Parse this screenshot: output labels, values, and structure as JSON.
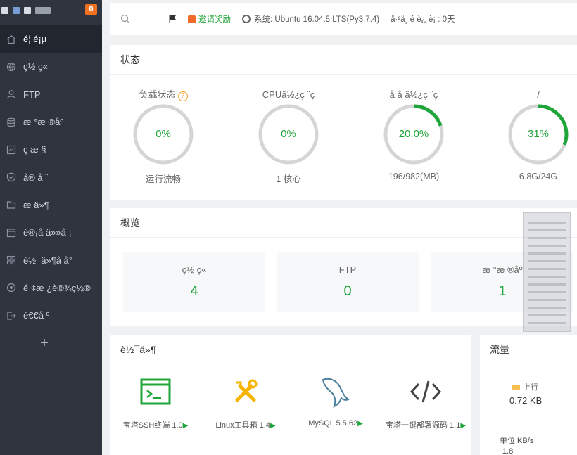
{
  "sidebar": {
    "badge": "0",
    "items": [
      {
        "label": "é¦ é¡µ",
        "icon": "home-icon",
        "active": true
      },
      {
        "label": "ç½ ç«",
        "icon": "globe-icon"
      },
      {
        "label": "FTP",
        "icon": "user-icon"
      },
      {
        "label": "æ °æ ®åº",
        "icon": "database-icon"
      },
      {
        "label": "ç æ §",
        "icon": "monitor-icon"
      },
      {
        "label": "å® å ¨",
        "icon": "shield-icon"
      },
      {
        "label": "æ ä»¶",
        "icon": "folder-icon"
      },
      {
        "label": "è®¡å ä»»å ¡",
        "icon": "task-icon"
      },
      {
        "label": "è½¯ä»¶å å°",
        "icon": "grid-icon"
      },
      {
        "label": "é ¢æ ¿è®¾ç½®",
        "icon": "settings-icon"
      },
      {
        "label": "é€€å º",
        "icon": "logout-icon"
      }
    ],
    "add_label": "+"
  },
  "header": {
    "invite": "邀请奖励",
    "system": "系统:  Ubuntu 16.04.5 LTS(Py3.7.4)",
    "uptime": "å·²ä¸ é è¿ è¡ : 0天"
  },
  "status": {
    "title": "状态",
    "gauges": [
      {
        "label": "负载状态",
        "value": "0%",
        "percent": 0,
        "sub": "运行流畅",
        "help": "?"
      },
      {
        "label": "CPUä½¿ç ¨ç",
        "value": "0%",
        "percent": 0,
        "sub": "1 核心"
      },
      {
        "label": "å å ä½¿ç ¨ç",
        "value": "20.0%",
        "percent": 20,
        "sub": "196/982(MB)"
      },
      {
        "label": "/",
        "value": "31%",
        "percent": 31,
        "sub": "6.8G/24G"
      }
    ],
    "colors": {
      "accent": "#20a53a",
      "track": "#d5d5d5"
    }
  },
  "overview": {
    "title": "概览",
    "cards": [
      {
        "label": "ç½ ç«",
        "value": "4"
      },
      {
        "label": "FTP",
        "value": "0"
      },
      {
        "label": "æ °æ ®åº",
        "value": "1"
      }
    ]
  },
  "software": {
    "title": "è½¯ä»¶",
    "items": [
      {
        "name": "宝塔SSH终端 1.0",
        "icon": "terminal-icon"
      },
      {
        "name": "Linux工具箱 1.4",
        "icon": "tools-icon"
      },
      {
        "name": "MySQL 5.5.62",
        "icon": "mysql-icon"
      },
      {
        "name": "宝塔一键部署源码 1.1",
        "icon": "code-icon"
      }
    ],
    "tri": "▶"
  },
  "traffic": {
    "title": "流量",
    "up_label": "上行",
    "up_value": "0.72 KB",
    "unit": "单位:KB/s",
    "tick": "1.8"
  }
}
